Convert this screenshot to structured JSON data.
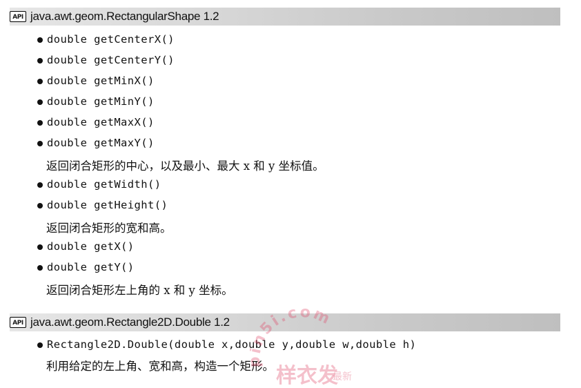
{
  "sections": [
    {
      "badge": "API",
      "title": "java.awt.geom.RectangularShape 1.2",
      "lines": [
        {
          "kind": "method",
          "text": "double getCenterX()"
        },
        {
          "kind": "method",
          "text": "double getCenterY()"
        },
        {
          "kind": "method",
          "text": "double getMinX()"
        },
        {
          "kind": "method",
          "text": "double getMinY()"
        },
        {
          "kind": "method",
          "text": "double getMaxX()"
        },
        {
          "kind": "method",
          "text": "double getMaxY()"
        },
        {
          "kind": "desc",
          "text": "返回闭合矩形的中心，以及最小、最大 x 和 y 坐标值。"
        },
        {
          "kind": "method",
          "text": "double getWidth()"
        },
        {
          "kind": "method",
          "text": "double getHeight()"
        },
        {
          "kind": "desc",
          "text": "返回闭合矩形的宽和高。"
        },
        {
          "kind": "method",
          "text": "double getX()"
        },
        {
          "kind": "method",
          "text": "double getY()"
        },
        {
          "kind": "desc",
          "text": "返回闭合矩形左上角的 x 和 y 坐标。"
        }
      ]
    },
    {
      "badge": "API",
      "title": "java.awt.geom.Rectangle2D.Double 1.2",
      "lines": [
        {
          "kind": "method",
          "text": "Rectangle2D.Double(double x,double y,double w,double h)"
        },
        {
          "kind": "desc",
          "text": "利用给定的左上角、宽和高，构造一个矩形。"
        }
      ]
    }
  ],
  "watermark": {
    "url_text": "pin5i.com",
    "chinese_text": "样衣发",
    "side_text": "最新"
  },
  "colors": {
    "text": "#111111",
    "header_bg_start": "#e6e6e6",
    "header_bg_end": "#bfbfbf",
    "watermark": "#e04a6a"
  }
}
